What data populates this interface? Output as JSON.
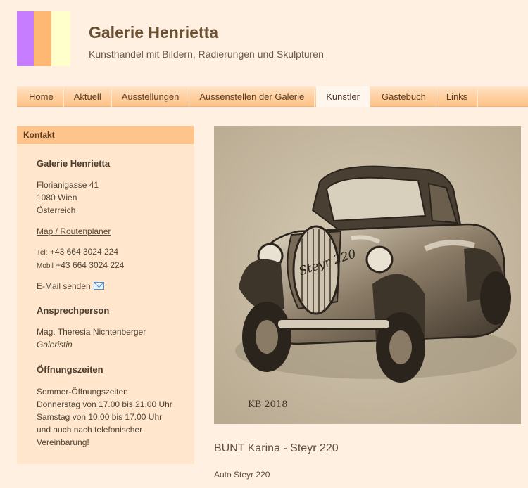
{
  "site": {
    "title": "Galerie Henrietta",
    "subtitle": "Kunsthandel mit Bildern, Radierungen und Skulpturen",
    "logo_colors": [
      "#c77dff",
      "#ffb774",
      "#ffffcc"
    ]
  },
  "nav": {
    "items": [
      {
        "label": "Home"
      },
      {
        "label": "Aktuell"
      },
      {
        "label": "Ausstellungen"
      },
      {
        "label": "Aussenstellen der Galerie"
      },
      {
        "label": "Künstler",
        "active": true
      },
      {
        "label": "Gästebuch"
      },
      {
        "label": "Links"
      }
    ]
  },
  "sidebar": {
    "heading": "Kontakt",
    "gallery_name": "Galerie Henrietta",
    "address": [
      "Florianigasse 41",
      "1080 Wien",
      "Österreich"
    ],
    "map_link": "Map / Routenplaner",
    "phone_label": "Tel:",
    "phone": "+43 664 3024 224",
    "mobile_label": "Mobil",
    "mobile": "+43 664 3024 224",
    "email_link": "E-Mail senden",
    "contact_heading": "Ansprechperson",
    "contact_name": "Mag. Theresia Nichtenberger",
    "contact_role": "Galeristin",
    "hours_heading": "Öffnungszeiten",
    "hours": [
      "Sommer-Öffnungszeiten",
      "Donnerstag von 17.00 bis 21.00 Uhr",
      "Samstag von 10.00 bis 17.00 Uhr",
      "und auch nach telefonischer",
      "Vereinbarung!"
    ]
  },
  "artwork": {
    "title": "BUNT Karina - Steyr 220",
    "description": "Auto Steyr 220",
    "signature": "KB 2018",
    "grille_text": "Steyr 220"
  }
}
